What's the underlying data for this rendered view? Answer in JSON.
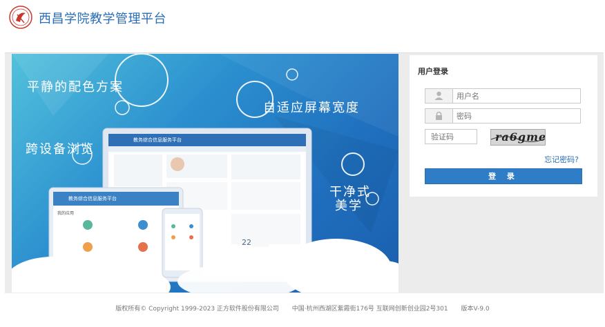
{
  "header": {
    "app_title": "西昌学院教学管理平台",
    "logo_icon": "school-seal-icon"
  },
  "banner": {
    "slogans": [
      "平静的配色方案",
      "自适应屏幕宽度",
      "跨设备浏览",
      "干净式",
      "美学"
    ],
    "laptop_app_name": "教务综合信息服务平台",
    "tablet_app_name": "教务综合信息服务平台",
    "tablet_section": "我的应用",
    "calendar_day": "22"
  },
  "login": {
    "title": "用户登录",
    "username_placeholder": "用户名",
    "password_placeholder": "密码",
    "captcha_placeholder": "验证码",
    "captcha_text": "ra6gme",
    "forgot_label": "忘记密码?",
    "login_button": "登 录"
  },
  "footer": {
    "copyright": "版权所有© Copyright 1999-2023 正方软件股份有限公司",
    "address": "中国·杭州西湖区紫霞街176号 互联网创新创业园2号301",
    "version": "版本V-9.0"
  },
  "colors": {
    "accent": "#2a6db5",
    "button": "#2f7cc7",
    "banner_light": "#52c1dc",
    "banner_dark": "#1b5fae"
  }
}
